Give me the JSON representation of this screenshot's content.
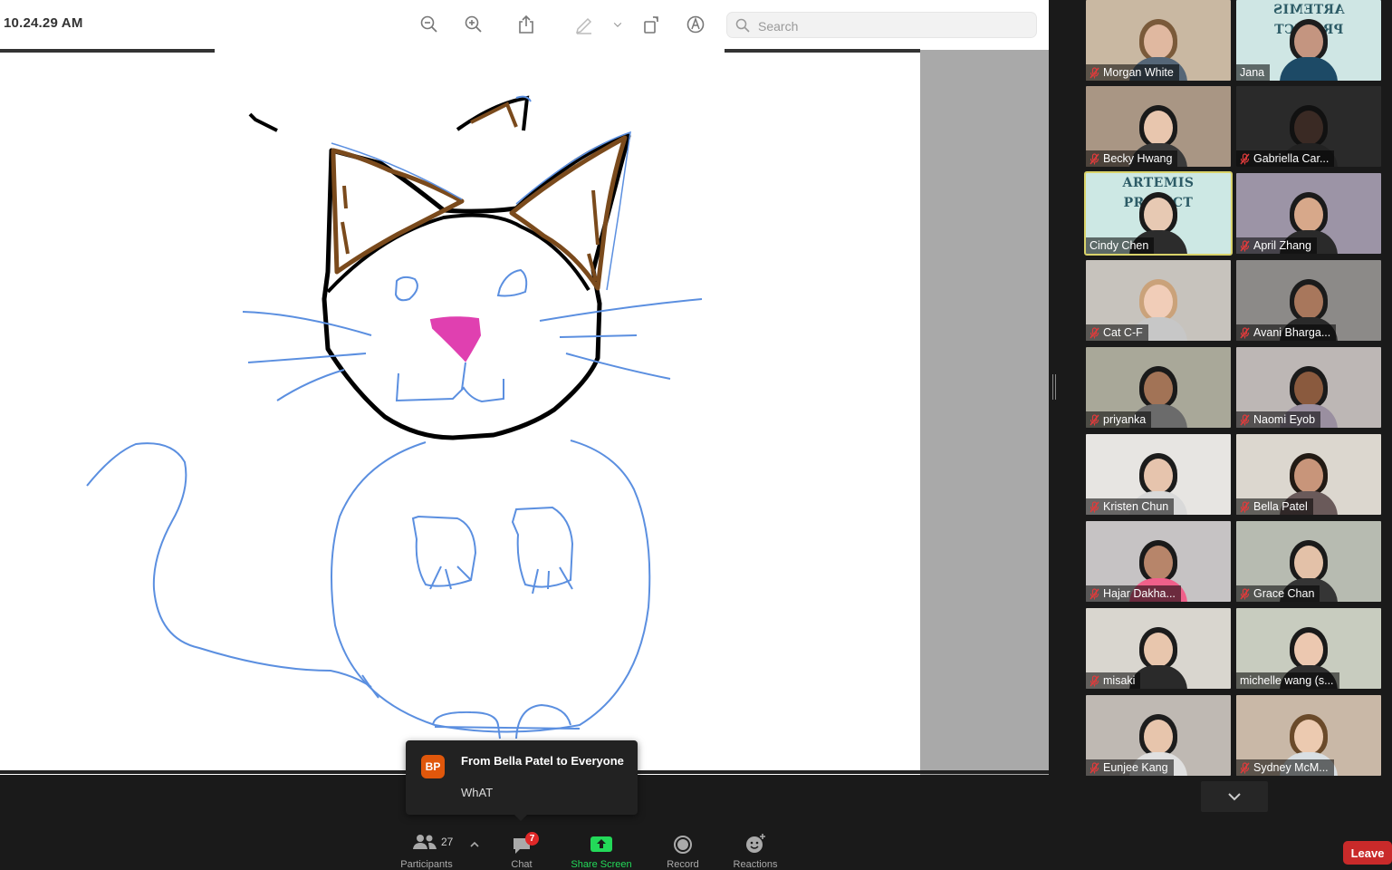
{
  "window": {
    "title": "10.24.29 AM"
  },
  "toolbar": {
    "search_placeholder": "Search",
    "icons": [
      "zoom-out-icon",
      "zoom-in-icon",
      "share-icon",
      "markup-pen-icon",
      "chevron-down-icon",
      "rotate-icon",
      "markup-circle-icon"
    ]
  },
  "participants": [
    {
      "name": "Morgan White",
      "muted": true
    },
    {
      "name": "Jana",
      "muted": false,
      "banner": "ARTEMIS PROJECT",
      "banner_mirrored": true
    },
    {
      "name": "Becky Hwang",
      "muted": true
    },
    {
      "name": "Gabriella Car...",
      "muted": true
    },
    {
      "name": "Cindy Chen",
      "muted": false,
      "banner": "ARTEMIS PROJECT",
      "active_speaker": true
    },
    {
      "name": "April Zhang",
      "muted": true
    },
    {
      "name": "Cat C-F",
      "muted": true
    },
    {
      "name": "Avani Bharga...",
      "muted": true
    },
    {
      "name": "priyanka",
      "muted": true
    },
    {
      "name": "Naomi Eyob",
      "muted": true
    },
    {
      "name": "Kristen Chun",
      "muted": true
    },
    {
      "name": "Bella Patel",
      "muted": true
    },
    {
      "name": "Hajar Dakha...",
      "muted": true
    },
    {
      "name": "Grace Chan",
      "muted": true
    },
    {
      "name": "misaki",
      "muted": true
    },
    {
      "name": "michelle wang (s...",
      "muted": false
    },
    {
      "name": "Eunjee Kang",
      "muted": true
    },
    {
      "name": "Sydney McM...",
      "muted": true
    }
  ],
  "chat_popup": {
    "avatar_initials": "BP",
    "from": "From Bella Patel to Everyone",
    "message": "WhAT"
  },
  "controls": {
    "participants": {
      "label": "Participants",
      "count": "27"
    },
    "chat": {
      "label": "Chat",
      "badge": "7"
    },
    "share": {
      "label": "Share Screen"
    },
    "record": {
      "label": "Record"
    },
    "reactions": {
      "label": "Reactions"
    },
    "leave": {
      "label": "Leave"
    }
  },
  "colors": {
    "share_green": "#23d959",
    "leave_red": "#c92a2a",
    "active_speaker_outline": "#d9d36a",
    "cat_outline": "#000000",
    "cat_ears": "#7a4a1c",
    "cat_nose": "#e040b0",
    "cat_body": "#5b8fe0"
  }
}
